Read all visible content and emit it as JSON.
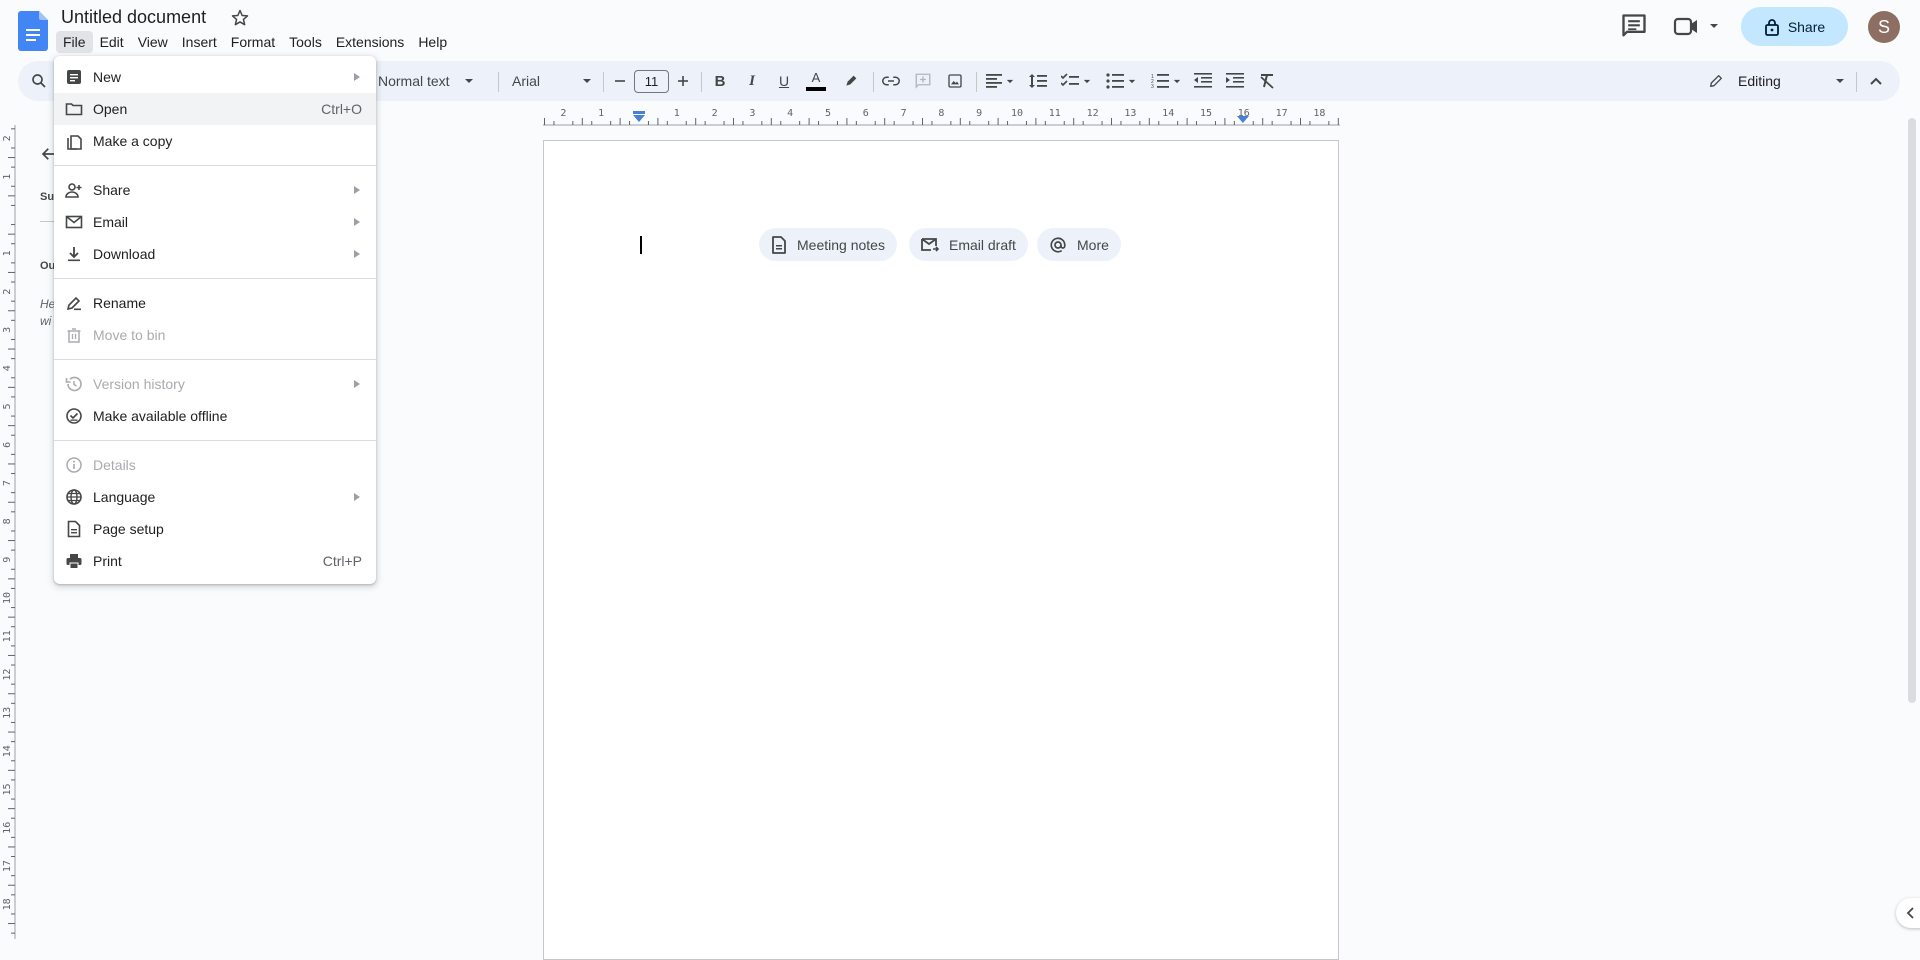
{
  "app": {
    "title": "Untitled document",
    "menu": [
      "File",
      "Edit",
      "View",
      "Insert",
      "Format",
      "Tools",
      "Extensions",
      "Help"
    ],
    "active_menu": "File"
  },
  "header": {
    "share_label": "Share",
    "avatar_initial": "S",
    "icons": [
      "comments-icon",
      "video-call-icon",
      "lock-icon"
    ]
  },
  "toolbar": {
    "style": "Normal text",
    "font": "Arial",
    "font_size": "11",
    "mode": "Editing",
    "text_color": "#000000"
  },
  "ruler": {
    "horizontal_ticks": [
      "2",
      "1",
      "1",
      "2",
      "3",
      "4",
      "5",
      "6",
      "7",
      "8",
      "9",
      "10",
      "11",
      "12",
      "13",
      "14",
      "15",
      "16",
      "17",
      "18"
    ],
    "vertical_ticks": [
      "2",
      "1",
      "1",
      "2",
      "3",
      "4",
      "5",
      "6",
      "7",
      "8",
      "9",
      "10",
      "11",
      "12",
      "13",
      "14",
      "15",
      "16",
      "17",
      "18"
    ]
  },
  "outline": {
    "summary_partial": "Su",
    "outline_partial": "Ou",
    "hint_partial_1": "He",
    "hint_partial_2": "wi"
  },
  "document": {
    "chips": [
      {
        "label": "Meeting notes",
        "icon": "document-icon"
      },
      {
        "label": "Email draft",
        "icon": "email-draft-icon"
      },
      {
        "label": "More",
        "icon": "at-sign-icon"
      }
    ]
  },
  "file_menu": {
    "items": [
      {
        "label": "New",
        "icon": "new-doc-icon",
        "submenu": true,
        "disabled": false
      },
      {
        "label": "Open",
        "icon": "folder-icon",
        "shortcut": "Ctrl+O",
        "disabled": false,
        "hover": true
      },
      {
        "label": "Make a copy",
        "icon": "copy-icon",
        "disabled": false
      },
      {
        "label": "Share",
        "icon": "person-add-icon",
        "submenu": true,
        "disabled": false
      },
      {
        "label": "Email",
        "icon": "email-icon",
        "submenu": true,
        "disabled": false
      },
      {
        "label": "Download",
        "icon": "download-icon",
        "submenu": true,
        "disabled": false
      },
      {
        "label": "Rename",
        "icon": "rename-icon",
        "disabled": false
      },
      {
        "label": "Move to bin",
        "icon": "trash-icon",
        "disabled": true
      },
      {
        "label": "Version history",
        "icon": "history-icon",
        "submenu": true,
        "disabled": true
      },
      {
        "label": "Make available offline",
        "icon": "offline-icon",
        "disabled": false
      },
      {
        "label": "Details",
        "icon": "info-icon",
        "disabled": true
      },
      {
        "label": "Language",
        "icon": "globe-icon",
        "submenu": true,
        "disabled": false
      },
      {
        "label": "Page setup",
        "icon": "page-setup-icon",
        "disabled": false
      },
      {
        "label": "Print",
        "icon": "print-icon",
        "shortcut": "Ctrl+P",
        "disabled": false
      }
    ]
  },
  "colors": {
    "brand_blue": "#4285f4",
    "share_bg": "#c2e7ff",
    "toolbar_bg": "#edf2fa",
    "avatar_bg": "#8d6e63"
  }
}
